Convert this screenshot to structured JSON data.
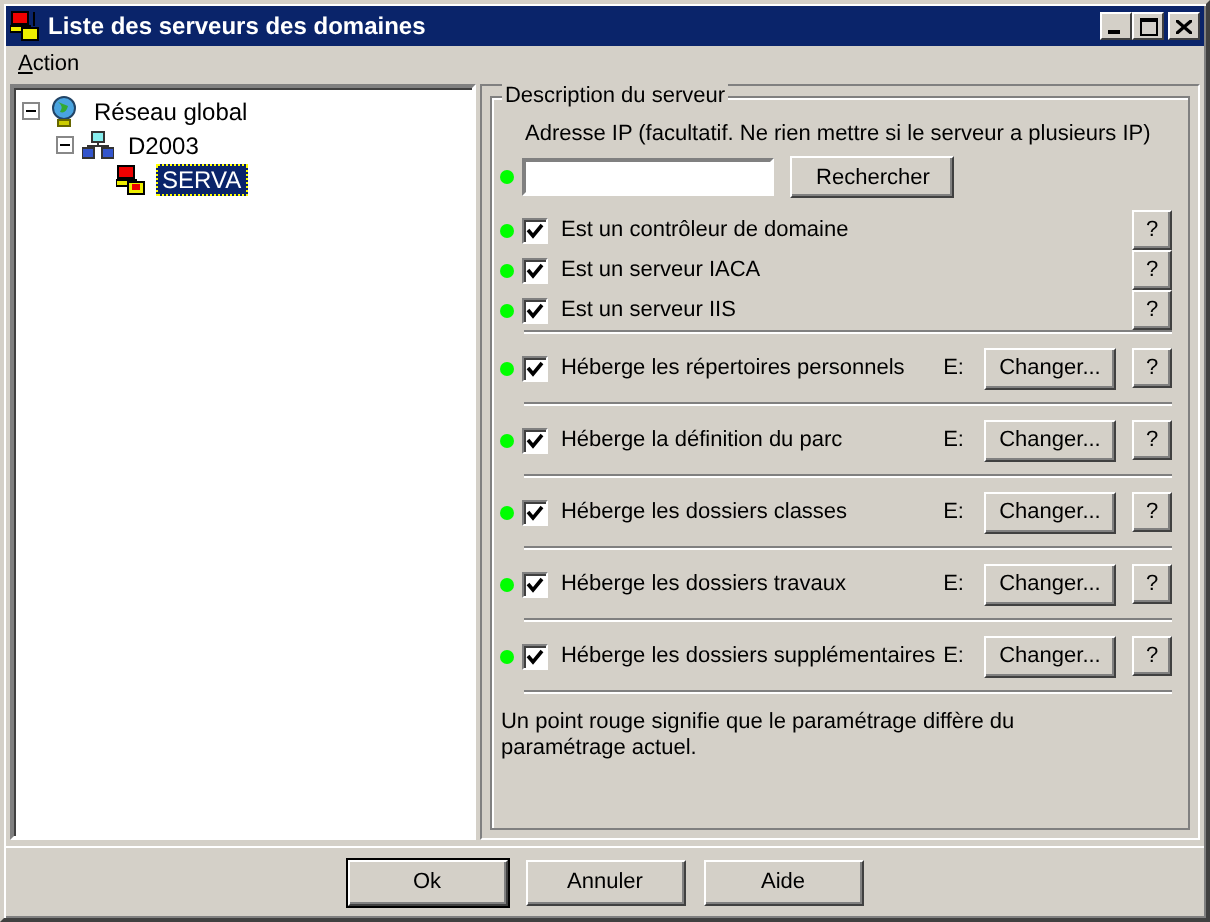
{
  "window": {
    "title": "Liste des serveurs des domaines"
  },
  "menu": [
    {
      "label": "Action"
    }
  ],
  "tree": [
    {
      "label": "Réseau global",
      "kind": "globe",
      "expanded": true,
      "selected": false,
      "children": [
        {
          "label": "D2003",
          "kind": "network",
          "expanded": true,
          "selected": false,
          "children": [
            {
              "label": "SERVA",
              "kind": "server",
              "selected": true
            }
          ]
        }
      ]
    }
  ],
  "panel": {
    "title": "Description du serveur",
    "ip": {
      "label": "Adresse IP (facultatif. Ne rien mettre si le serveur a plusieurs IP)",
      "button": "Rechercher",
      "color": "#00ff00"
    },
    "rows": [
      {
        "kind": "role",
        "label": "Est un contrôleur de domaine",
        "checked": true,
        "color": "#00ff00",
        "help": "?"
      },
      {
        "kind": "role",
        "label": "Est un serveur IACA",
        "checked": true,
        "color": "#00ff00",
        "help": "?"
      },
      {
        "kind": "role",
        "label": "Est un serveur IIS",
        "checked": true,
        "color": "#00ff00",
        "help": "?"
      },
      {
        "kind": "share",
        "label": "Héberge les répertoires personnels",
        "checked": true,
        "color": "#00ff00",
        "drive": "E:",
        "button": "Changer...",
        "help": "?"
      },
      {
        "kind": "share",
        "label": "Héberge la définition du parc",
        "checked": true,
        "color": "#00ff00",
        "drive": "E:",
        "button": "Changer...",
        "help": "?"
      },
      {
        "kind": "share",
        "label": "Héberge les dossiers classes",
        "checked": true,
        "color": "#00ff00",
        "drive": "E:",
        "button": "Changer...",
        "help": "?"
      },
      {
        "kind": "share",
        "label": "Héberge les dossiers travaux",
        "checked": true,
        "color": "#00ff00",
        "drive": "E:",
        "button": "Changer...",
        "help": "?"
      },
      {
        "kind": "share",
        "label": "Héberge les dossiers supplémentaires",
        "checked": true,
        "color": "#00ff00",
        "drive": "E:",
        "button": "Changer...",
        "help": "?"
      }
    ],
    "note": "Un point rouge signifie que le paramétrage diffère du paramétrage actuel."
  },
  "buttons": [
    {
      "label": "Ok",
      "default": true
    },
    {
      "label": "Annuler",
      "default": false
    },
    {
      "label": "Aide",
      "default": false
    }
  ]
}
